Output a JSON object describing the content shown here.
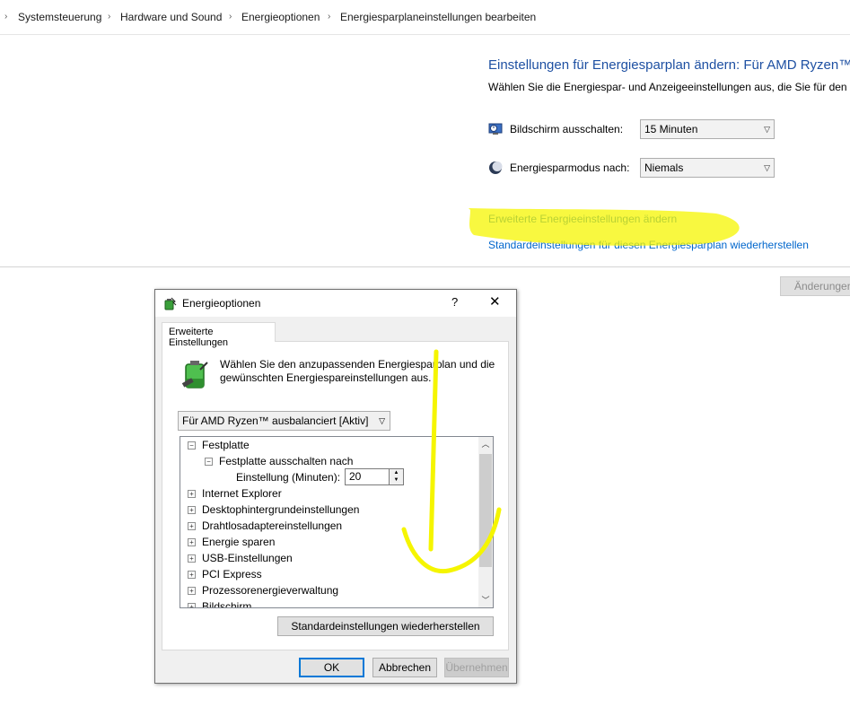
{
  "breadcrumb": [
    "Systemsteuerung",
    "Hardware und Sound",
    "Energieoptionen",
    "Energiesparplaneinstellungen bearbeiten"
  ],
  "main": {
    "title": "Einstellungen für Energiesparplan ändern: Für AMD Ryzen™",
    "subtitle": "Wählen Sie die Energiespar- und Anzeigeeinstellungen aus, die Sie für den Co",
    "display_off_label": "Bildschirm ausschalten:",
    "display_off_value": "15 Minuten",
    "sleep_label": "Energiesparmodus nach:",
    "sleep_value": "Niemals",
    "advanced_link": "Erweiterte Energieeinstellungen ändern",
    "restore_link": "Standardeinstellungen für diesen Energiesparplan wiederherstellen",
    "save_button": "Änderungen"
  },
  "dialog": {
    "title": "Energieoptionen",
    "help": "?",
    "close": "✕",
    "tab": "Erweiterte Einstellungen",
    "description": "Wählen Sie den anzupassenden Energiesparplan und die gewünschten Energiespareinstellungen aus.",
    "plan_value": "Für AMD Ryzen™ ausbalanciert [Aktiv]",
    "tree": {
      "festplatte": "Festplatte",
      "festplatte_aus": "Festplatte ausschalten nach",
      "einstellung_label": "Einstellung (Minuten):",
      "einstellung_value": "20",
      "items": [
        "Internet Explorer",
        "Desktophintergrundeinstellungen",
        "Drahtlosadaptereinstellungen",
        "Energie sparen",
        "USB-Einstellungen",
        "PCI Express",
        "Prozessorenergieverwaltung",
        "Bildschirm"
      ]
    },
    "restore_button": "Standardeinstellungen wiederherstellen",
    "ok_button": "OK",
    "cancel_button": "Abbrechen",
    "apply_button": "Übernehmen"
  },
  "colors": {
    "highlight": "#f5f500",
    "link": "#0066cc",
    "title": "#1e50a2"
  }
}
